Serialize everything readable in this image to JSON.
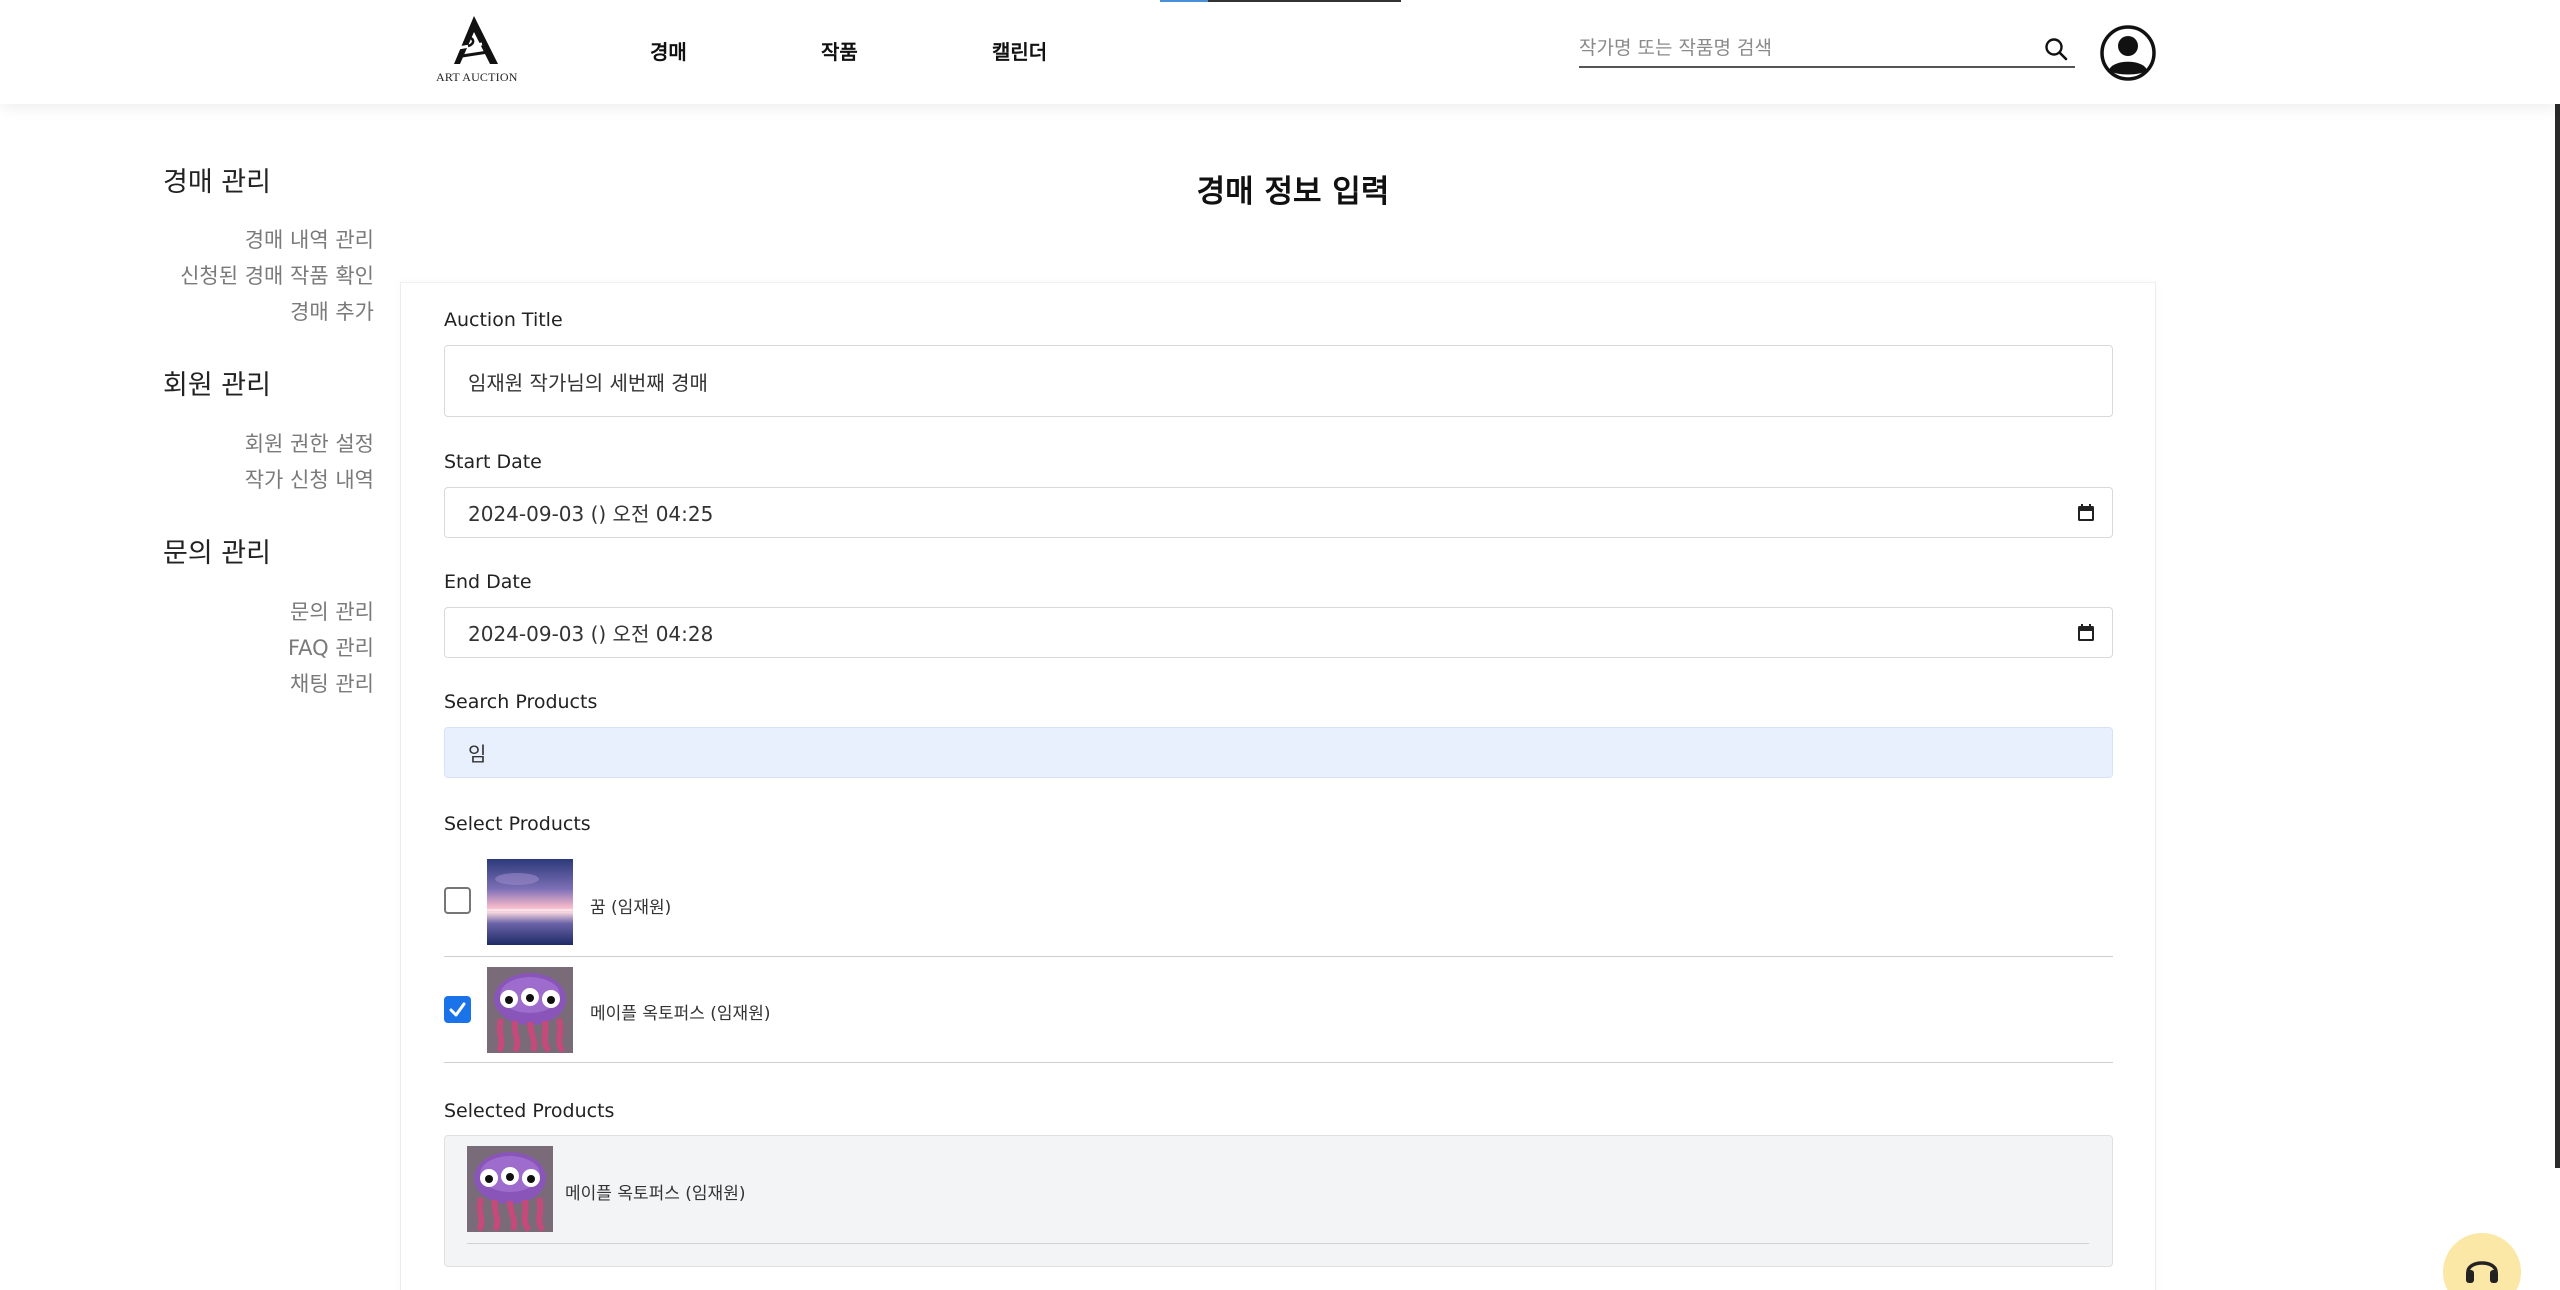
{
  "header": {
    "logo_text": "ART AUCTION",
    "nav": [
      {
        "label": "경매"
      },
      {
        "label": "작품"
      },
      {
        "label": "캘린더"
      }
    ],
    "search": {
      "placeholder": "작가명 또는 작품명 검색",
      "value": ""
    },
    "icons": {
      "search": "search-icon",
      "avatar": "user-avatar-icon"
    }
  },
  "sidebar": {
    "groups": [
      {
        "title": "경매 관리",
        "items": [
          {
            "label": "경매 내역 관리"
          },
          {
            "label": "신청된 경매 작품 확인"
          },
          {
            "label": "경매 추가"
          }
        ]
      },
      {
        "title": "회원 관리",
        "items": [
          {
            "label": "회원 권한 설정"
          },
          {
            "label": "작가 신청 내역"
          }
        ]
      },
      {
        "title": "문의 관리",
        "items": [
          {
            "label": "문의 관리"
          },
          {
            "label": "FAQ 관리"
          },
          {
            "label": "채팅 관리"
          }
        ]
      }
    ]
  },
  "form": {
    "page_title": "경매 정보 입력",
    "auction_title": {
      "label": "Auction Title",
      "value": "임재원 작가님의 세번째 경매"
    },
    "start_date": {
      "label": "Start Date",
      "value": "2024-09-03 () 오전 04:25"
    },
    "end_date": {
      "label": "End Date",
      "value": "2024-09-03 () 오전 04:28"
    },
    "search_products": {
      "label": "Search Products",
      "value": "임"
    },
    "select_products": {
      "label": "Select Products",
      "items": [
        {
          "name": "꿈 (임재원)",
          "checked": false,
          "thumb": "sunset-lake-image"
        },
        {
          "name": "메이플 옥토퍼스 (임재원)",
          "checked": true,
          "thumb": "octopus-character-image"
        }
      ]
    },
    "selected_products": {
      "label": "Selected Products",
      "items": [
        {
          "name": "메이플 옥토퍼스 (임재원)",
          "thumb": "octopus-character-image"
        }
      ]
    }
  },
  "colors": {
    "accent_blue": "#1a73e8",
    "search_field_bg": "#e8f0fe",
    "chat_button_bg": "#fbe7a6"
  }
}
